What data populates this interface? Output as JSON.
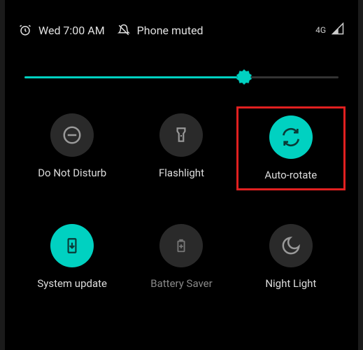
{
  "status": {
    "time": "Wed 7:00 AM",
    "phone_state": "Phone muted",
    "network": "4G"
  },
  "brightness": {
    "value_pct": 70
  },
  "tiles": {
    "dnd": {
      "label": "Do Not Disturb"
    },
    "flashlight": {
      "label": "Flashlight"
    },
    "autorotate": {
      "label": "Auto-rotate"
    },
    "sysupdate": {
      "label": "System update"
    },
    "battery": {
      "label": "Battery Saver"
    },
    "night": {
      "label": "Night Light"
    }
  }
}
